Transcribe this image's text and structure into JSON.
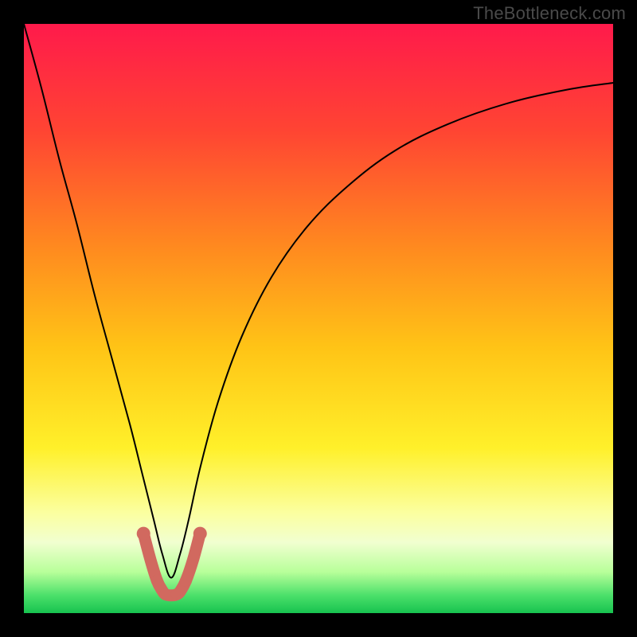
{
  "watermark": "TheBottleneck.com",
  "chart_data": {
    "type": "line",
    "title": "",
    "xlabel": "",
    "ylabel": "",
    "xlim": [
      0,
      100
    ],
    "ylim": [
      0,
      100
    ],
    "grid": false,
    "legend": false,
    "background_gradient_stops": [
      {
        "offset": 0.0,
        "color": "#ff1a4b"
      },
      {
        "offset": 0.18,
        "color": "#ff4433"
      },
      {
        "offset": 0.38,
        "color": "#ff8a1f"
      },
      {
        "offset": 0.55,
        "color": "#ffc416"
      },
      {
        "offset": 0.72,
        "color": "#fff02a"
      },
      {
        "offset": 0.83,
        "color": "#fbffa0"
      },
      {
        "offset": 0.88,
        "color": "#f1ffd0"
      },
      {
        "offset": 0.93,
        "color": "#b8ff9a"
      },
      {
        "offset": 0.97,
        "color": "#4be06a"
      },
      {
        "offset": 1.0,
        "color": "#17c24f"
      }
    ],
    "series": [
      {
        "name": "bottleneck-curve",
        "color": "#000000",
        "width": 2,
        "x": [
          0.0,
          3.0,
          6.0,
          9.0,
          12.0,
          15.0,
          18.0,
          20.0,
          22.0,
          23.5,
          25.0,
          26.5,
          28.0,
          30.0,
          33.0,
          37.0,
          42.0,
          48.0,
          55.0,
          63.0,
          72.0,
          82.0,
          92.0,
          100.0
        ],
        "y": [
          100.0,
          89.0,
          77.0,
          66.0,
          54.0,
          43.0,
          32.0,
          24.0,
          16.0,
          10.0,
          6.0,
          10.0,
          16.0,
          25.0,
          36.0,
          47.0,
          57.0,
          65.5,
          72.5,
          78.5,
          83.0,
          86.5,
          88.8,
          90.0
        ]
      },
      {
        "name": "valley-highlight",
        "color": "#d1695f",
        "width": 15,
        "linecap": "round",
        "points_marker": true,
        "x": [
          20.3,
          21.5,
          22.6,
          23.5,
          24.0,
          25.0,
          26.0,
          26.6,
          27.5,
          28.7,
          29.9
        ],
        "y": [
          13.5,
          9.0,
          5.5,
          3.8,
          3.2,
          3.0,
          3.2,
          3.8,
          5.5,
          9.0,
          13.5
        ]
      }
    ]
  }
}
